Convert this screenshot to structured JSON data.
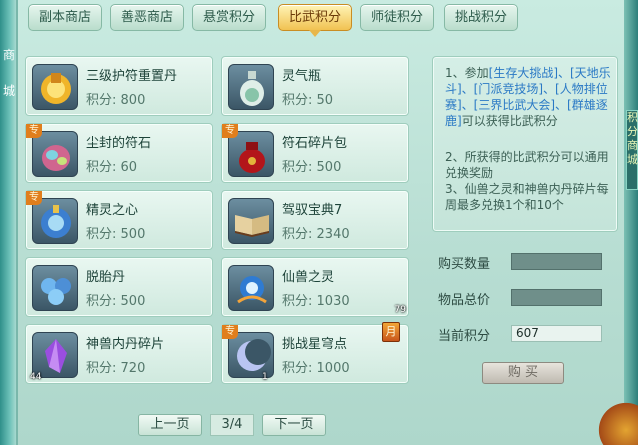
{
  "tabs": [
    {
      "label": "副本商店"
    },
    {
      "label": "善恶商店"
    },
    {
      "label": "悬赏积分"
    },
    {
      "label": "比武积分",
      "active": true
    },
    {
      "label": "师徒积分"
    },
    {
      "label": "挑战积分"
    }
  ],
  "price_prefix": "积分:",
  "items": [
    {
      "name": "三级护符重置丹",
      "price": "800",
      "icon": "golden-talisman-icon"
    },
    {
      "name": "灵气瓶",
      "price": "50",
      "icon": "spirit-vase-icon"
    },
    {
      "name": "尘封的符石",
      "price": "60",
      "icon": "rune-stone-icon",
      "badge": "专"
    },
    {
      "name": "符石碎片包",
      "price": "500",
      "icon": "red-pouch-icon",
      "badge": "专"
    },
    {
      "name": "精灵之心",
      "price": "500",
      "icon": "spirit-heart-icon",
      "badge": "专"
    },
    {
      "name": "驾驭宝典7",
      "price": "2340",
      "icon": "open-book-icon"
    },
    {
      "name": "脱胎丹",
      "price": "500",
      "icon": "blue-pill-icon"
    },
    {
      "name": "仙兽之灵",
      "price": "1030",
      "icon": "beast-spirit-icon",
      "count": "79"
    },
    {
      "name": "神兽内丹碎片",
      "price": "720",
      "icon": "purple-crystal-icon",
      "count": "44"
    },
    {
      "name": "挑战星穹点",
      "price": "1000",
      "icon": "crescent-moon-icon",
      "badge": "专",
      "count": "1",
      "month_badge": "月"
    }
  ],
  "pager": {
    "prev": "上一页",
    "page": "3/4",
    "next": "下一页"
  },
  "info": {
    "line1_pre": "1、参加",
    "line1_links": "[生存大挑战]、[天地乐斗]、[门派竞技场]、[人物排位赛]、[三界比武大会]、[群雄逐鹿]",
    "line1_post": "可以获得比武积分",
    "line2": "2、所获得的比武积分可以通用兑换奖励",
    "line3": "3、仙兽之灵和神兽内丹碎片每周最多兑换1个和10个"
  },
  "purchase": {
    "qty_label": "购买数量",
    "qty_value": "",
    "total_label": "物品总价",
    "total_value": "",
    "points_label": "当前积分",
    "points_value": "607",
    "buy_label": "购 买"
  },
  "side_text": {
    "left": [
      "商",
      "城"
    ],
    "right": [
      "积",
      "分",
      "商",
      "城"
    ]
  }
}
